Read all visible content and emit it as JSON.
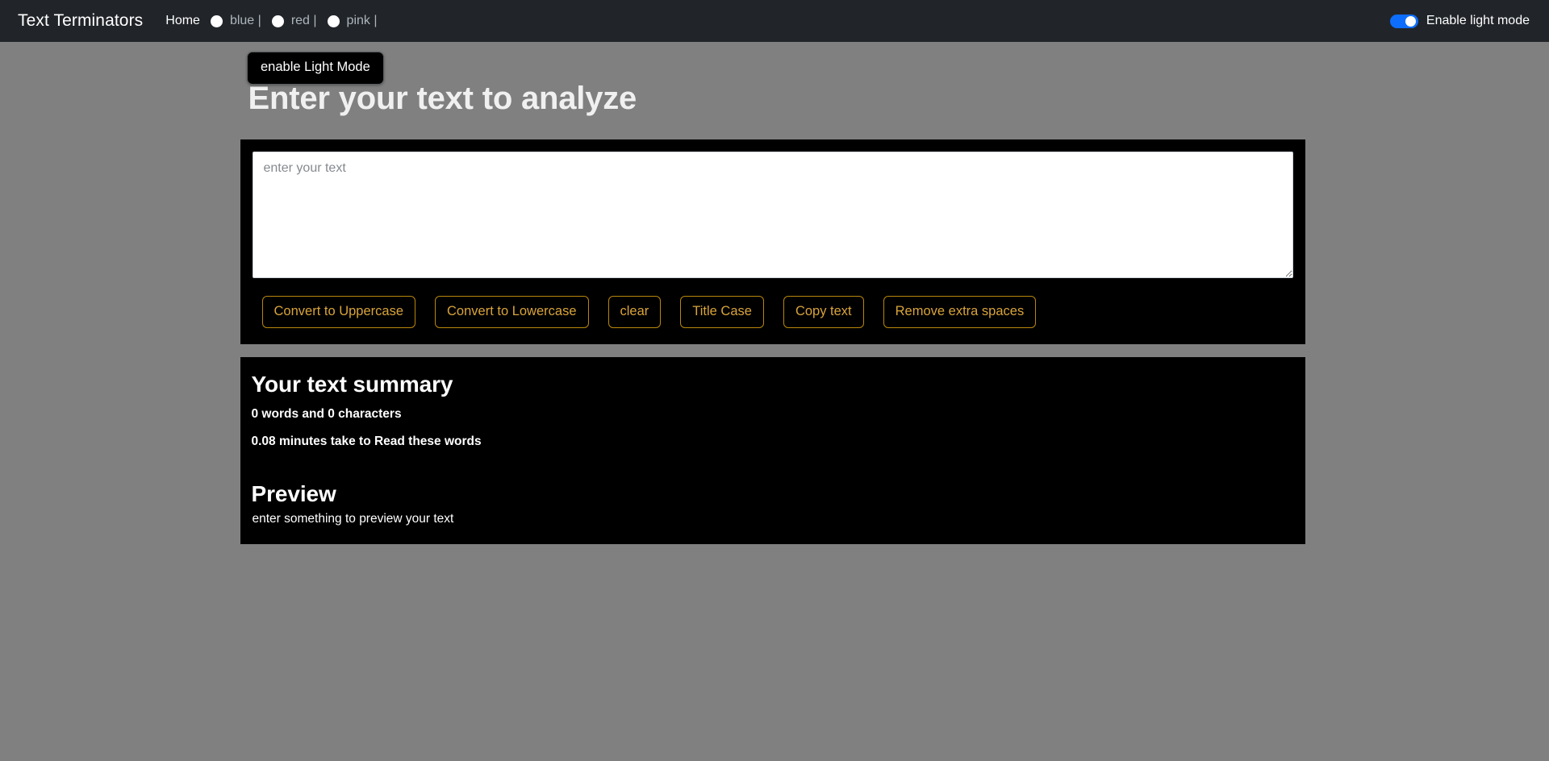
{
  "navbar": {
    "brand": "Text Terminators",
    "home_label": "Home",
    "theme_options": [
      {
        "label": "blue |",
        "icon": "radio-icon"
      },
      {
        "label": "red |",
        "icon": "radio-icon"
      },
      {
        "label": "pink |",
        "icon": "radio-icon"
      }
    ],
    "light_mode_switch_label": "Enable light mode",
    "light_mode_switch_on": true,
    "accent_color": "#0d6efd",
    "background_color": "#212529"
  },
  "tooltip": {
    "text": "enable Light Mode"
  },
  "main": {
    "page_title": "Enter your text to analyze",
    "textarea": {
      "placeholder": "enter your text",
      "value": ""
    },
    "buttons": [
      {
        "label": "Convert to Uppercase"
      },
      {
        "label": "Convert to Lowercase"
      },
      {
        "label": "clear"
      },
      {
        "label": "Title Case"
      },
      {
        "label": "Copy text"
      },
      {
        "label": "Remove extra spaces"
      }
    ],
    "button_accent_color": "#d9a43a",
    "summary": {
      "title": "Your text summary",
      "counts": "0 words and 0 characters",
      "read_time": "0.08 minutes take to Read these words",
      "preview_title": "Preview",
      "preview_empty": "enter something to preview your text"
    }
  },
  "page_background_color": "#808080"
}
